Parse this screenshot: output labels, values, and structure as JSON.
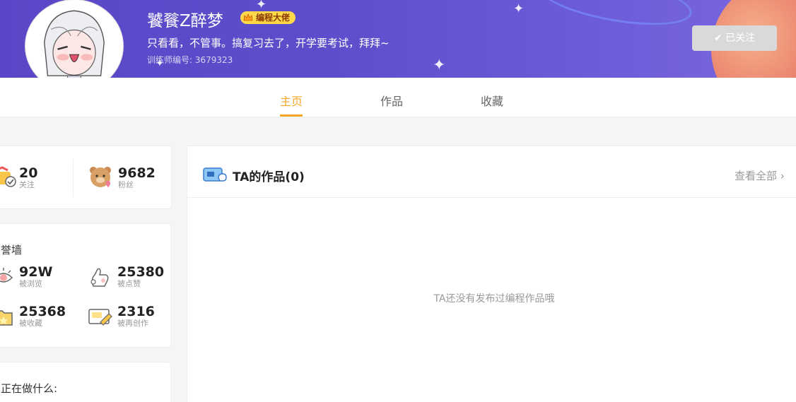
{
  "profile": {
    "username": "饕餮Z醉梦",
    "badge": "编程大佬",
    "bio": "只看看，不管事。搞复习去了，开学要考试，拜拜~",
    "trainer_id": "训练师编号: 3679323",
    "follow_label": "已关注"
  },
  "tabs": [
    {
      "label": "主页",
      "active": true
    },
    {
      "label": "作品",
      "active": false
    },
    {
      "label": "收藏",
      "active": false
    }
  ],
  "social": {
    "following": {
      "value": "20",
      "label": "关注"
    },
    "fans": {
      "value": "9682",
      "label": "粉丝"
    }
  },
  "honor_wall": {
    "title": "誉墙",
    "stats": [
      {
        "value": "92W",
        "label": "被浏览"
      },
      {
        "value": "25380",
        "label": "被点赞"
      },
      {
        "value": "25368",
        "label": "被收藏"
      },
      {
        "value": "2316",
        "label": "被再创作"
      }
    ]
  },
  "status": {
    "title": "正在做什么:"
  },
  "works": {
    "title": "TA的作品(0)",
    "view_all": "查看全部",
    "empty_message": "TA还没有发布过编程作品哦"
  },
  "colors": {
    "accent": "#f5a623",
    "banner": "#5a47c7",
    "badge": "#ffd84a"
  }
}
